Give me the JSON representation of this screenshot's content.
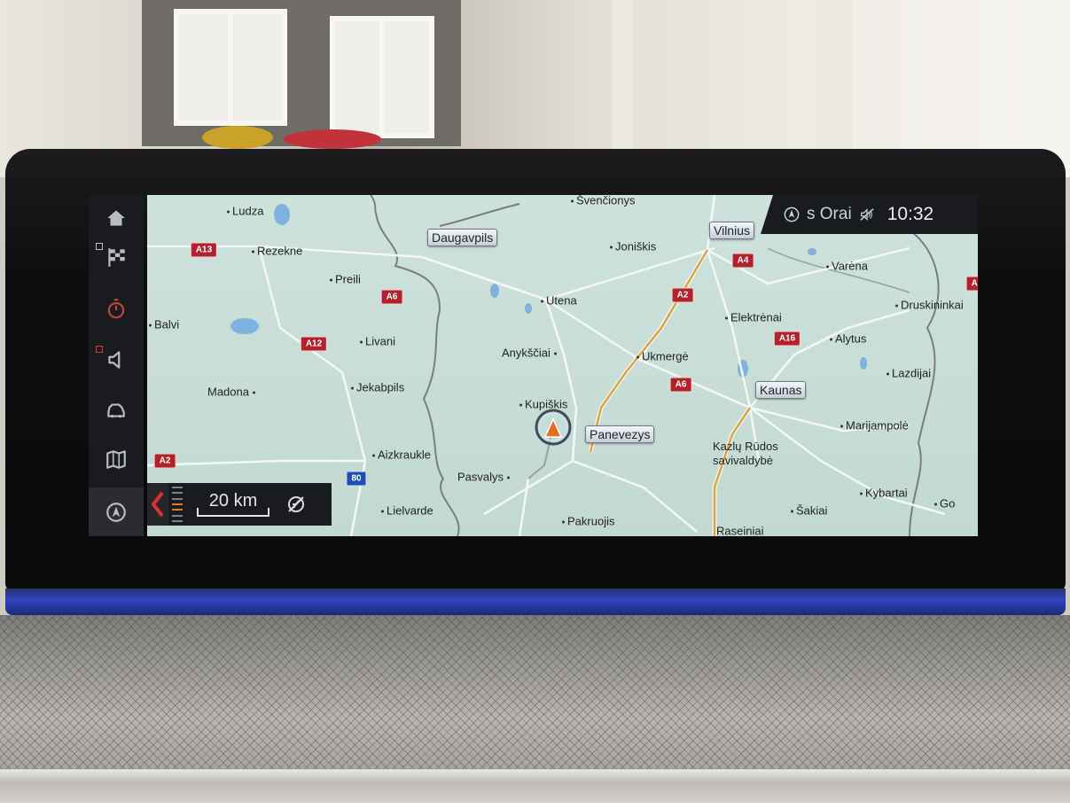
{
  "status": {
    "nav_icon": "navigation-compass-icon",
    "channel": "s Orai",
    "mute_icon": "mute-icon",
    "time": "10:32"
  },
  "sidebar": {
    "items": [
      {
        "name": "home",
        "icon": "home-icon"
      },
      {
        "name": "destination",
        "icon": "checkered-flag-icon"
      },
      {
        "name": "timer",
        "icon": "stopwatch-icon"
      },
      {
        "name": "media",
        "icon": "speaker-icon"
      },
      {
        "name": "vehicle",
        "icon": "car-icon"
      },
      {
        "name": "map",
        "icon": "map-icon"
      },
      {
        "name": "navigation",
        "icon": "navigation-arrow-icon"
      }
    ]
  },
  "map": {
    "cities": [
      {
        "name": "Ludza"
      },
      {
        "name": "Rezekne"
      },
      {
        "name": "Preili"
      },
      {
        "name": "Balvi"
      },
      {
        "name": "Livani"
      },
      {
        "name": "Madona"
      },
      {
        "name": "Jekabpils"
      },
      {
        "name": "Aizkraukle"
      },
      {
        "name": "Lielvarde"
      },
      {
        "name": "Pasvalys"
      },
      {
        "name": "Pakruojis"
      },
      {
        "name": "Kupiškis"
      },
      {
        "name": "Anykščiai"
      },
      {
        "name": "Utena"
      },
      {
        "name": "Joniškis"
      },
      {
        "name": "Švenčionys"
      },
      {
        "name": "Ukmergė"
      },
      {
        "name": "Elektrėnai"
      },
      {
        "name": "Alytus"
      },
      {
        "name": "Varėna"
      },
      {
        "name": "Druskininkai"
      },
      {
        "name": "Lazdijai"
      },
      {
        "name": "Marijampolė"
      },
      {
        "name": "Kazlų Rūdos savivaldybė"
      },
      {
        "name": "Šakiai"
      },
      {
        "name": "Kybartai"
      },
      {
        "name": "Raseiniai"
      },
      {
        "name": "Go"
      }
    ],
    "major_cities": [
      {
        "name": "Daugavpils"
      },
      {
        "name": "Vilnius"
      },
      {
        "name": "Kaunas"
      },
      {
        "name": "Panevezys"
      }
    ],
    "roads": [
      "A13",
      "A6",
      "A12",
      "A2",
      "A6",
      "A2",
      "A4",
      "A16",
      "A6",
      "80"
    ]
  },
  "scale": {
    "label": "20 km",
    "zoom_level": 0.4
  },
  "colors": {
    "road_shield": "#b3222c",
    "highway_line": "#d9a441",
    "border_line": "#7b7d80",
    "vehicle": "#e36b1c"
  }
}
